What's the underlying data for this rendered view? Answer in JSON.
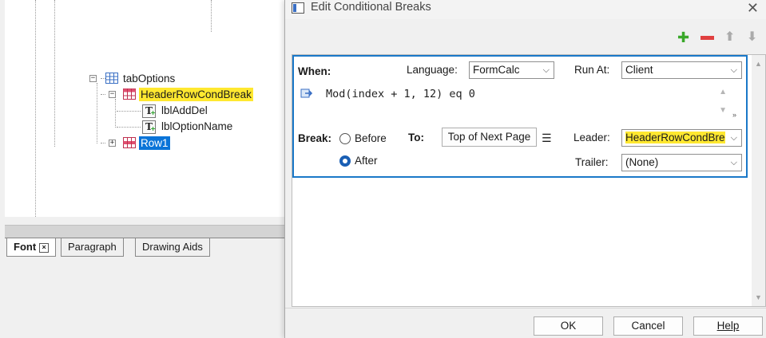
{
  "tree": {
    "items": [
      {
        "label": "tabOptions",
        "expander": "−"
      },
      {
        "label": "HeaderRowCondBreak",
        "expander": "−"
      },
      {
        "label": "lblAddDel"
      },
      {
        "label": "lblOptionName"
      },
      {
        "label": "Row1",
        "expander": "+"
      }
    ]
  },
  "bottom_tabs": [
    {
      "label": "Font",
      "close": "×"
    },
    {
      "label": "Paragraph"
    },
    {
      "label": "Drawing Aids"
    }
  ],
  "dialog": {
    "title": "Edit Conditional Breaks",
    "close_glyph": "✕",
    "toolbar": {
      "add": "✚",
      "up": "⬆",
      "down": "⬇"
    },
    "item": {
      "when_label": "When:",
      "language_label": "Language:",
      "language_value": "FormCalc",
      "runat_label": "Run At:",
      "runat_value": "Client",
      "script": "Mod(index + 1, 12) eq 0",
      "break_label": "Break:",
      "before_label": "Before",
      "after_label": "After",
      "selected_break": "After",
      "to_label": "To:",
      "to_value": "Top of Next Page",
      "leader_label": "Leader:",
      "leader_value": "HeaderRowCondBre",
      "trailer_label": "Trailer:",
      "trailer_value": "(None)"
    },
    "buttons": {
      "ok": "OK",
      "cancel": "Cancel",
      "help": "Help"
    }
  },
  "colors": {
    "selection_blue": "#0a74d8",
    "highlight_yellow": "#ffe830",
    "frame_blue": "#1a78c8"
  }
}
